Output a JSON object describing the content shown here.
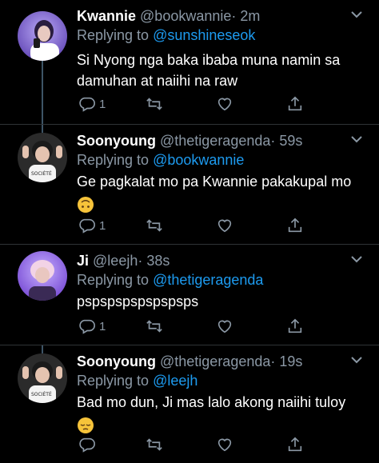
{
  "tweets": [
    {
      "name": "Kwannie",
      "handle": "@bookwannie",
      "time": "· 2m",
      "replying_prefix": "Replying to ",
      "replying_to": "@sunshineseok",
      "body": "Si Nyong nga baka ibaba muna namin sa damuhan at naiihi na raw",
      "emoji": "",
      "reply_count": "1"
    },
    {
      "name": "Soonyoung",
      "handle": "@thetigeragenda",
      "time": "· 59s",
      "replying_prefix": "Replying to ",
      "replying_to": "@bookwannie",
      "body": "Ge pagkalat mo pa Kwannie pakakupal mo",
      "emoji": "upside-down-face",
      "reply_count": "1"
    },
    {
      "name": "Ji",
      "handle": "@leejh",
      "time": "· 38s",
      "replying_prefix": "Replying to ",
      "replying_to": "@thetigeragenda",
      "body": "pspspspspspspsps",
      "emoji": "",
      "reply_count": "1"
    },
    {
      "name": "Soonyoung",
      "handle": "@thetigeragenda",
      "time": "· 19s",
      "replying_prefix": "Replying to ",
      "replying_to": "@leejh",
      "body": "Bad mo dun, Ji mas lalo akong naiihi tuloy",
      "emoji": "pensive-face",
      "reply_count": ""
    }
  ],
  "icons": {
    "reply": "reply-icon",
    "retweet": "retweet-icon",
    "like": "heart-icon",
    "share": "share-icon",
    "more": "chevron-down-icon"
  },
  "colors": {
    "background": "#000000",
    "text": "#ffffff",
    "secondary": "#8b98a5",
    "link": "#1d9bf0",
    "thread_line": "#3d5466"
  }
}
